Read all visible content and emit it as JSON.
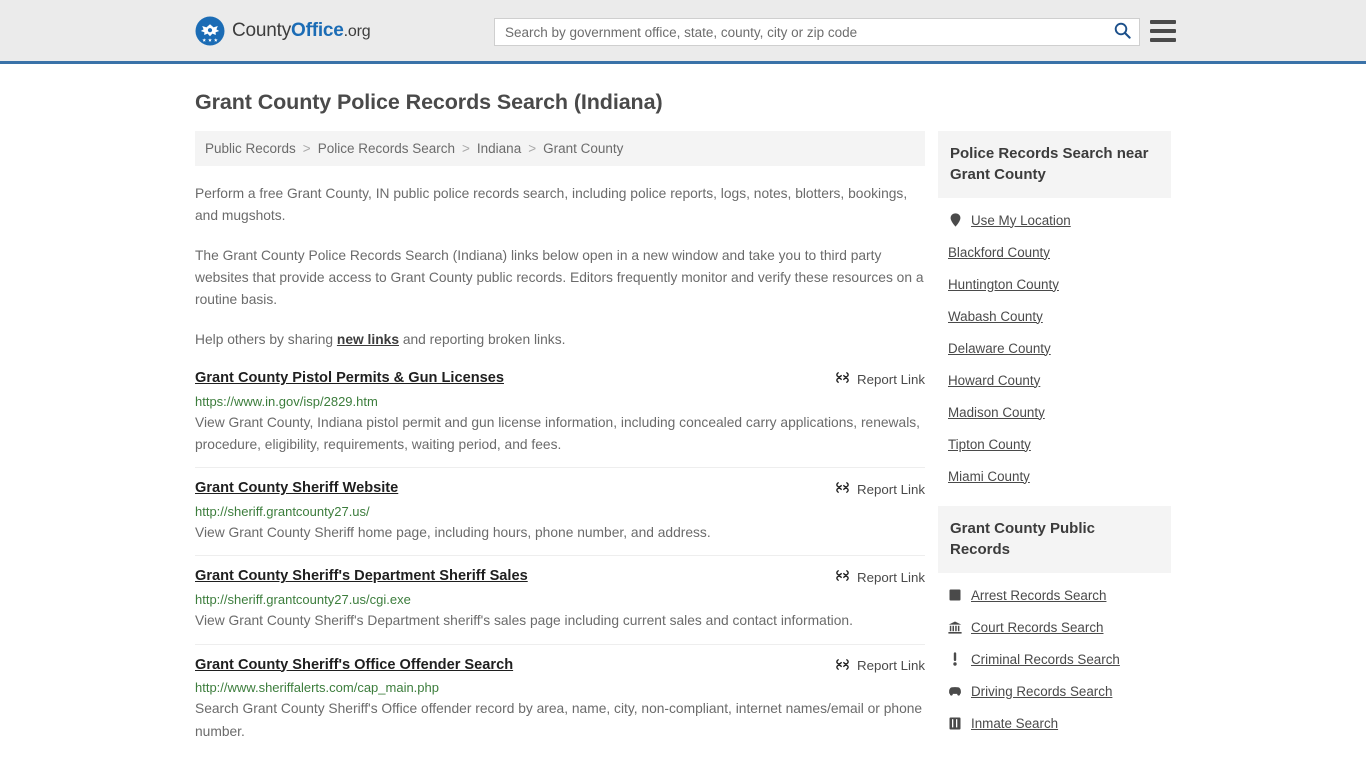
{
  "header": {
    "logo": {
      "icon": "eagle-seal-icon",
      "part1": "County",
      "part2": "Office",
      "part3": ".org"
    },
    "search": {
      "placeholder": "Search by government office, state, county, city or zip code",
      "value": "",
      "search_icon": "search-icon"
    },
    "menu_icon": "hamburger-menu-icon",
    "accent_color": "#3a72a8",
    "background_color": "#ebebeb"
  },
  "page_title": "Grant County Police Records Search (Indiana)",
  "breadcrumb": {
    "separator": ">",
    "items": [
      {
        "label": "Public Records"
      },
      {
        "label": "Police Records Search"
      },
      {
        "label": "Indiana"
      },
      {
        "label": "Grant County"
      }
    ]
  },
  "intro": {
    "paragraph1": "Perform a free Grant County, IN public police records search, including police reports, logs, notes, blotters, bookings, and mugshots.",
    "paragraph2": "The Grant County Police Records Search (Indiana) links below open in a new window and take you to third party websites that provide access to Grant County public records. Editors frequently monitor and verify these resources on a routine basis.",
    "paragraph3_before": "Help others by sharing ",
    "paragraph3_link": "new links",
    "paragraph3_after": " and reporting broken links."
  },
  "report_link_label": "Report Link",
  "report_link_icon": "broken-link-icon",
  "results": [
    {
      "title": "Grant County Pistol Permits & Gun Licenses",
      "url": "https://www.in.gov/isp/2829.htm",
      "description": "View Grant County, Indiana pistol permit and gun license information, including concealed carry applications, renewals, procedure, eligibility, requirements, waiting period, and fees."
    },
    {
      "title": "Grant County Sheriff Website",
      "url": "http://sheriff.grantcounty27.us/",
      "description": "View Grant County Sheriff home page, including hours, phone number, and address."
    },
    {
      "title": "Grant County Sheriff's Department Sheriff Sales",
      "url": "http://sheriff.grantcounty27.us/cgi.exe",
      "description": "View Grant County Sheriff's Department sheriff's sales page including current sales and contact information."
    },
    {
      "title": "Grant County Sheriff's Office Offender Search",
      "url": "http://www.sheriffalerts.com/cap_main.php",
      "description": "Search Grant County Sheriff's Office offender record by area, name, city, non-compliant, internet names/email or phone number."
    }
  ],
  "sidebar": {
    "nearby": {
      "heading": "Police Records Search near Grant County",
      "items": [
        {
          "label": "Use My Location",
          "icon": "map-pin-icon"
        },
        {
          "label": "Blackford County",
          "icon": ""
        },
        {
          "label": "Huntington County",
          "icon": ""
        },
        {
          "label": "Wabash County",
          "icon": ""
        },
        {
          "label": "Delaware County",
          "icon": ""
        },
        {
          "label": "Howard County",
          "icon": ""
        },
        {
          "label": "Madison County",
          "icon": ""
        },
        {
          "label": "Tipton County",
          "icon": ""
        },
        {
          "label": "Miami County",
          "icon": ""
        }
      ]
    },
    "public_records": {
      "heading": "Grant County Public Records",
      "items": [
        {
          "label": "Arrest Records Search",
          "icon": "fingerprint-icon"
        },
        {
          "label": "Court Records Search",
          "icon": "courthouse-icon"
        },
        {
          "label": "Criminal Records Search",
          "icon": "exclamation-icon"
        },
        {
          "label": "Driving Records Search",
          "icon": "car-icon"
        },
        {
          "label": "Inmate Search",
          "icon": "jail-icon"
        }
      ]
    }
  }
}
